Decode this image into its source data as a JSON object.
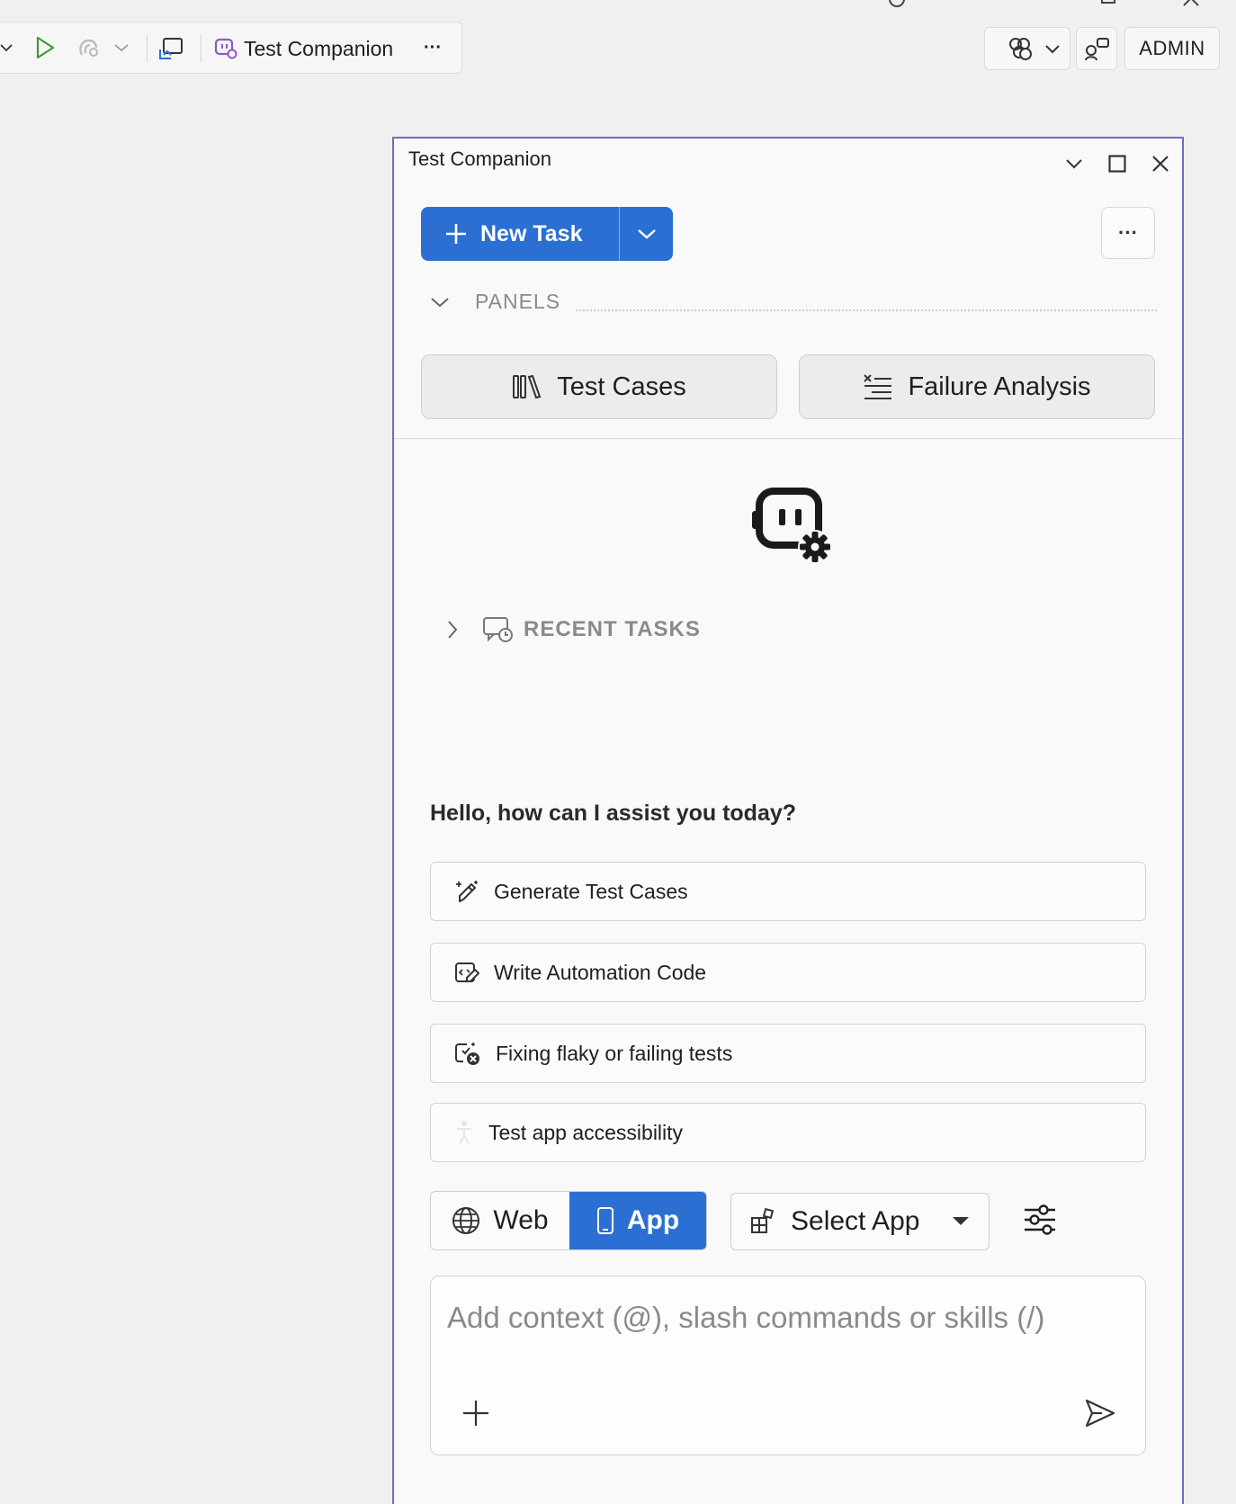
{
  "toolbar": {
    "companion_label": "Test Companion",
    "more_label": "···",
    "admin_label": "ADMIN"
  },
  "panel": {
    "title": "Test Companion",
    "new_task_label": "New Task",
    "more_label": "···",
    "panels_heading": "PANELS",
    "panel_cards": [
      {
        "label": "Test Cases",
        "icon": "library-icon"
      },
      {
        "label": "Failure Analysis",
        "icon": "list-x-icon"
      }
    ],
    "recent_tasks_heading": "RECENT TASKS",
    "greeting": "Hello, how can I assist you today?",
    "suggestions": [
      {
        "label": "Generate Test Cases",
        "icon": "magic-pen-icon"
      },
      {
        "label": "Write Automation Code",
        "icon": "code-edit-icon"
      },
      {
        "label": "Fixing flaky or failing tests",
        "icon": "test-error-icon"
      },
      {
        "label": "Test app accessibility",
        "icon": "accessibility-icon"
      }
    ],
    "mode": {
      "web_label": "Web",
      "app_label": "App",
      "selected": "App"
    },
    "select_app_label": "Select App",
    "chat": {
      "placeholder": "Add context (@), slash commands or skills (/)",
      "value": ""
    }
  },
  "colors": {
    "accent": "#2b6fd3",
    "panel_border": "#6e6cc0",
    "run_green": "#3c9a3c",
    "companion_purple": "#8b5cc7"
  }
}
